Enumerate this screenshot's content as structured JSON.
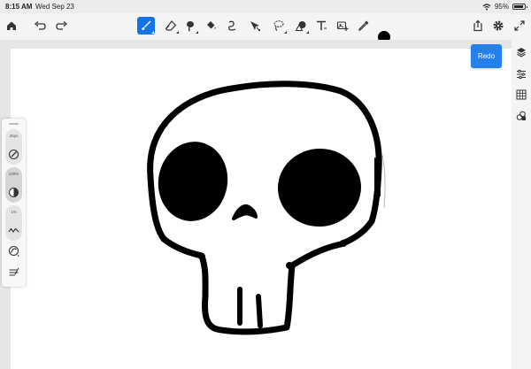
{
  "status_bar": {
    "time": "8:15 AM",
    "date": "Wed Sep 23",
    "battery": "95%",
    "icons": [
      "wifi-icon",
      "battery-icon"
    ]
  },
  "toolbar": {
    "left_icons": [
      "home-icon",
      "undo-icon",
      "redo-icon"
    ],
    "tools": [
      "brush-tool-icon",
      "eraser-tool-icon",
      "smudge-tool-icon",
      "fill-tool-icon",
      "liquify-tool-icon",
      "transform-tool-icon",
      "lasso-tool-icon",
      "shape-tool-icon",
      "text-tool-icon",
      "image-tool-icon",
      "eyedropper-icon"
    ],
    "active_tool": "brush-tool-icon",
    "current_color": "#000000",
    "right_icons": [
      "share-icon",
      "settings-icon",
      "fullscreen-icon"
    ]
  },
  "tooltip": {
    "redo_label": "Redo"
  },
  "brush_panel": {
    "size_label": "25px",
    "opacity_label": "100%",
    "smoothing_label": "1%"
  },
  "right_panel": {
    "icons": [
      "layers-icon",
      "properties-icon",
      "grid-icon",
      "link-layers-icon"
    ]
  },
  "colors": {
    "accent": "#1473e6",
    "ink": "#000000",
    "paper": "#ffffff"
  }
}
